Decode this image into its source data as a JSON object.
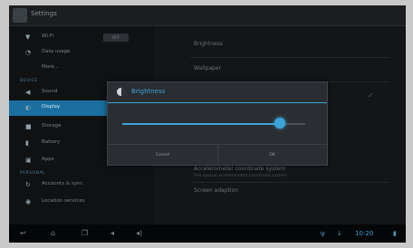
{
  "actionbar": {
    "title": "Settings",
    "icon": "settings-app-icon"
  },
  "sidebar": {
    "items": [
      {
        "label": "Wi-Fi",
        "icon": "wifi-icon",
        "toggle": "OFF"
      },
      {
        "label": "Data usage",
        "icon": "data-usage-icon"
      },
      {
        "label": "More...",
        "icon": ""
      },
      {
        "label": "Sound",
        "icon": "volume-icon"
      },
      {
        "label": "Display",
        "icon": "display-icon"
      },
      {
        "label": "Storage",
        "icon": "storage-icon"
      },
      {
        "label": "Battery",
        "icon": "battery-icon"
      },
      {
        "label": "Apps",
        "icon": "apps-icon"
      },
      {
        "label": "Accounts & sync",
        "icon": "sync-icon"
      },
      {
        "label": "Location services",
        "icon": "location-icon"
      }
    ],
    "sections": [
      "DEVICE",
      "PERSONAL"
    ]
  },
  "display_pane": {
    "rows": [
      {
        "label": "Brightness"
      },
      {
        "label": "Wallpaper"
      },
      {
        "label": "Accelerometer coordinate system"
      },
      {
        "label": "Use special accelerometer coordinate system"
      },
      {
        "label": "Screen adaption"
      }
    ]
  },
  "dialog": {
    "title": "Brightness",
    "brightness_level": 0.86,
    "cancel_label": "Cancel",
    "ok_label": "OK"
  },
  "navbar": {
    "time": "10:20"
  },
  "colors": {
    "accent": "#3aa4d8",
    "selected": "#1a6fa0"
  }
}
